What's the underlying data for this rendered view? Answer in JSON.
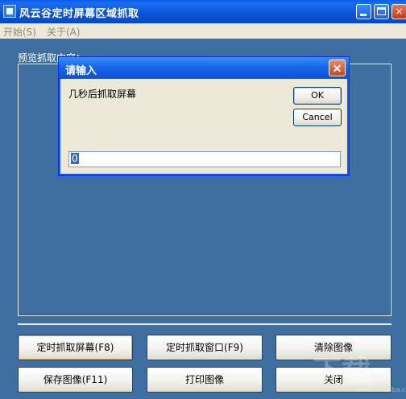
{
  "window": {
    "title": "风云谷定时屏幕区域抓取",
    "min_glyph": "",
    "max_glyph": "",
    "close_glyph": "×"
  },
  "menu": {
    "items": [
      "开始(S)",
      "关于(A)"
    ]
  },
  "preview": {
    "label": "预览抓取内容："
  },
  "buttons": {
    "timed_capture_screen": "定时抓取屏幕(F8)",
    "timed_capture_window": "定时抓取窗口(F9)",
    "clear_image": "清除图像",
    "save_image": "保存图像(F11)",
    "print_image": "打印图像",
    "close": "关闭"
  },
  "dialog": {
    "title": "请输入",
    "prompt": "几秒后抓取屏幕",
    "ok_label": "OK",
    "cancel_label": "Cancel",
    "input_value": "0"
  },
  "watermark": {
    "text": "下载",
    "url": "www.xiazaiba.com"
  },
  "colors": {
    "desktop_background": "#3e6fa0",
    "titlebar_blue": "#0c55d6",
    "dialog_background": "#ece9d8"
  }
}
